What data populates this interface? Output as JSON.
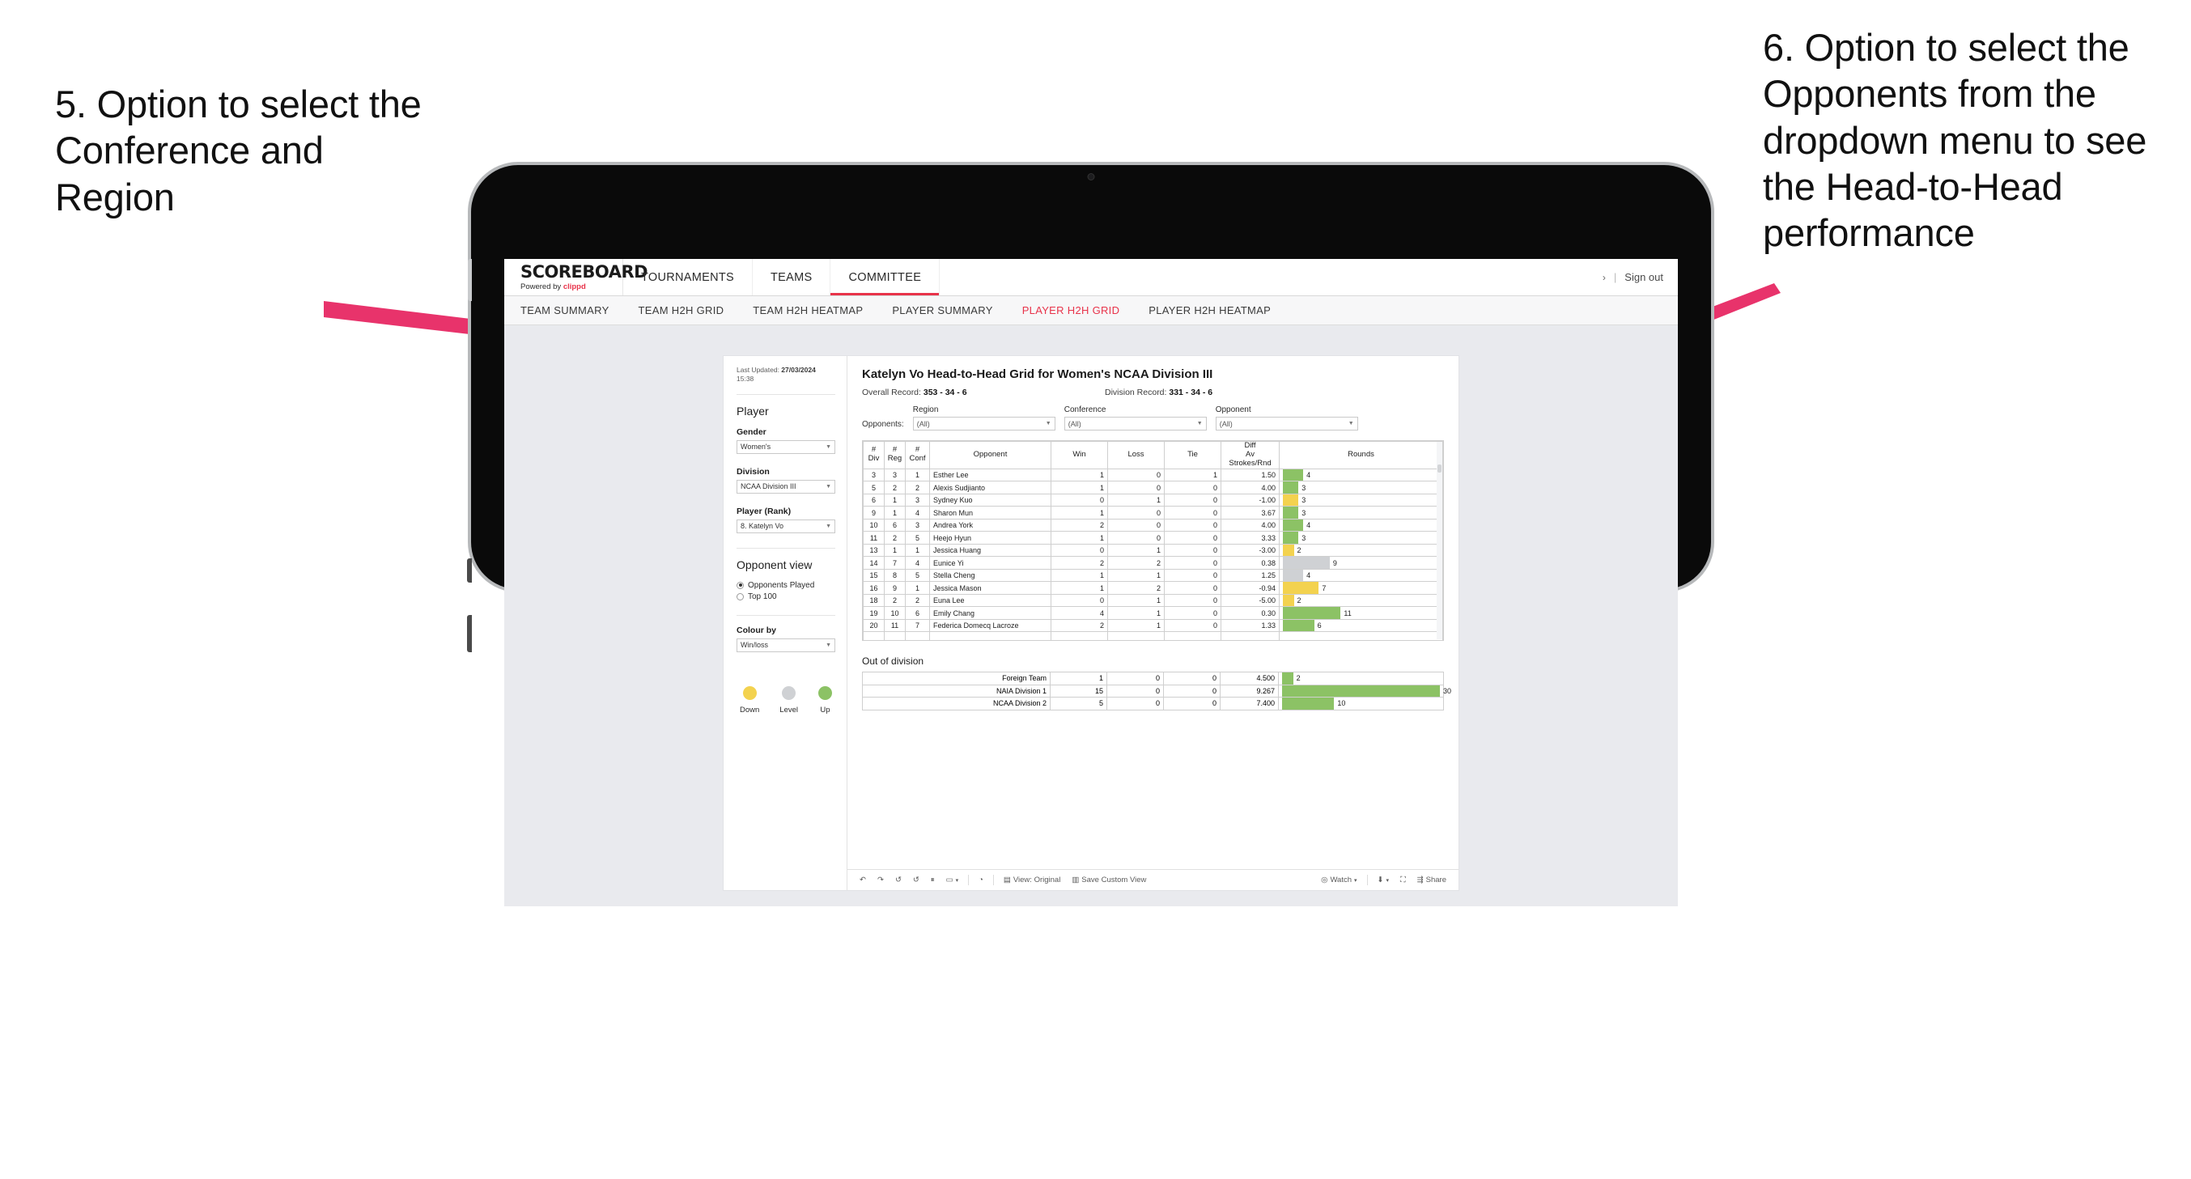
{
  "annotations": {
    "left": "5. Option to select the Conference and Region",
    "right": "6. Option to select the Opponents from the dropdown menu to see the Head-to-Head performance",
    "arrow_color": "#e8336b"
  },
  "app": {
    "brand": {
      "title": "SCOREBOARD",
      "powered_prefix": "Powered by ",
      "powered_name": "clippd"
    },
    "topnav": [
      {
        "label": "TOURNAMENTS",
        "active": false
      },
      {
        "label": "TEAMS",
        "active": false
      },
      {
        "label": "COMMITTEE",
        "active": true
      }
    ],
    "topbar_right": {
      "chevron": "›",
      "divider": "|",
      "sign_out": "Sign out"
    },
    "subnav": [
      {
        "label": "TEAM SUMMARY",
        "active": false
      },
      {
        "label": "TEAM H2H GRID",
        "active": false
      },
      {
        "label": "TEAM H2H HEATMAP",
        "active": false
      },
      {
        "label": "PLAYER SUMMARY",
        "active": false
      },
      {
        "label": "PLAYER H2H GRID",
        "active": true
      },
      {
        "label": "PLAYER H2H HEATMAP",
        "active": false
      }
    ]
  },
  "sidebar": {
    "last_updated_label": "Last Updated: ",
    "last_updated_value": "27/03/2024",
    "last_updated_time": "15:38",
    "player_heading": "Player",
    "gender_label": "Gender",
    "gender_value": "Women's",
    "division_label": "Division",
    "division_value": "NCAA Division III",
    "player_rank_label": "Player (Rank)",
    "player_rank_value": "8. Katelyn Vo",
    "opponent_view_heading": "Opponent view",
    "opponent_view_options": [
      {
        "label": "Opponents Played",
        "selected": true
      },
      {
        "label": "Top 100",
        "selected": false
      }
    ],
    "colour_by_label": "Colour by",
    "colour_by_value": "Win/loss",
    "legend": [
      {
        "label": "Down",
        "color": "#f3d24f"
      },
      {
        "label": "Level",
        "color": "#cfd1d4"
      },
      {
        "label": "Up",
        "color": "#8cc265"
      }
    ]
  },
  "main": {
    "title": "Katelyn Vo Head-to-Head Grid for Women's NCAA Division III",
    "overall_record_label": "Overall Record: ",
    "overall_record_value": "353 - 34 - 6",
    "division_record_label": "Division Record: ",
    "division_record_value": "331 - 34 - 6",
    "opponents_label": "Opponents:",
    "filters": [
      {
        "label": "Region",
        "value": "(All)"
      },
      {
        "label": "Conference",
        "value": "(All)"
      },
      {
        "label": "Opponent",
        "value": "(All)"
      }
    ],
    "out_of_division_title": "Out of division"
  },
  "chart_data": {
    "type": "table",
    "title": "Katelyn Vo Head-to-Head Grid for Women's NCAA Division III",
    "columns": [
      "# Div",
      "# Reg",
      "# Conf",
      "Opponent",
      "Win",
      "Loss",
      "Tie",
      "Diff Av Strokes/Rnd",
      "Rounds"
    ],
    "rounds_max": 30,
    "rows": [
      {
        "div": "3",
        "reg": "3",
        "conf": "1",
        "opponent": "Esther Lee",
        "win": "1",
        "loss": "0",
        "tie": "1",
        "diff": "1.50",
        "rounds": 4,
        "color": "up"
      },
      {
        "div": "5",
        "reg": "2",
        "conf": "2",
        "opponent": "Alexis Sudjianto",
        "win": "1",
        "loss": "0",
        "tie": "0",
        "diff": "4.00",
        "rounds": 3,
        "color": "up"
      },
      {
        "div": "6",
        "reg": "1",
        "conf": "3",
        "opponent": "Sydney Kuo",
        "win": "0",
        "loss": "1",
        "tie": "0",
        "diff": "-1.00",
        "rounds": 3,
        "color": "down"
      },
      {
        "div": "9",
        "reg": "1",
        "conf": "4",
        "opponent": "Sharon Mun",
        "win": "1",
        "loss": "0",
        "tie": "0",
        "diff": "3.67",
        "rounds": 3,
        "color": "up"
      },
      {
        "div": "10",
        "reg": "6",
        "conf": "3",
        "opponent": "Andrea York",
        "win": "2",
        "loss": "0",
        "tie": "0",
        "diff": "4.00",
        "rounds": 4,
        "color": "up"
      },
      {
        "div": "11",
        "reg": "2",
        "conf": "5",
        "opponent": "Heejo Hyun",
        "win": "1",
        "loss": "0",
        "tie": "0",
        "diff": "3.33",
        "rounds": 3,
        "color": "up"
      },
      {
        "div": "13",
        "reg": "1",
        "conf": "1",
        "opponent": "Jessica Huang",
        "win": "0",
        "loss": "1",
        "tie": "0",
        "diff": "-3.00",
        "rounds": 2,
        "color": "down"
      },
      {
        "div": "14",
        "reg": "7",
        "conf": "4",
        "opponent": "Eunice Yi",
        "win": "2",
        "loss": "2",
        "tie": "0",
        "diff": "0.38",
        "rounds": 9,
        "color": "level",
        "diff_color": "up"
      },
      {
        "div": "15",
        "reg": "8",
        "conf": "5",
        "opponent": "Stella Cheng",
        "win": "1",
        "loss": "1",
        "tie": "0",
        "diff": "1.25",
        "rounds": 4,
        "color": "level",
        "diff_color": "up"
      },
      {
        "div": "16",
        "reg": "9",
        "conf": "1",
        "opponent": "Jessica Mason",
        "win": "1",
        "loss": "2",
        "tie": "0",
        "diff": "-0.94",
        "rounds": 7,
        "color": "down"
      },
      {
        "div": "18",
        "reg": "2",
        "conf": "2",
        "opponent": "Euna Lee",
        "win": "0",
        "loss": "1",
        "tie": "0",
        "diff": "-5.00",
        "rounds": 2,
        "color": "down"
      },
      {
        "div": "19",
        "reg": "10",
        "conf": "6",
        "opponent": "Emily Chang",
        "win": "4",
        "loss": "1",
        "tie": "0",
        "diff": "0.30",
        "rounds": 11,
        "color": "up"
      },
      {
        "div": "20",
        "reg": "11",
        "conf": "7",
        "opponent": "Federica Domecq Lacroze",
        "win": "2",
        "loss": "1",
        "tie": "0",
        "diff": "1.33",
        "rounds": 6,
        "color": "up"
      }
    ],
    "out_of_division": {
      "rounds_max": 30,
      "rows": [
        {
          "name": "Foreign Team",
          "win": "1",
          "loss": "0",
          "tie": "0",
          "diff": "4.500",
          "rounds": 2,
          "color": "up"
        },
        {
          "name": "NAIA Division 1",
          "win": "15",
          "loss": "0",
          "tie": "0",
          "diff": "9.267",
          "rounds": 30,
          "color": "up"
        },
        {
          "name": "NCAA Division 2",
          "win": "5",
          "loss": "0",
          "tie": "0",
          "diff": "7.400",
          "rounds": 10,
          "color": "up"
        }
      ]
    }
  },
  "toolbar": {
    "items": [
      {
        "name": "undo-icon",
        "glyph": "↶",
        "label": ""
      },
      {
        "name": "redo-icon",
        "glyph": "↷",
        "label": ""
      },
      {
        "name": "revert-icon",
        "glyph": "↺",
        "label": ""
      },
      {
        "name": "refresh-icon",
        "glyph": "↺",
        "label": ""
      },
      {
        "name": "pause-icon",
        "glyph": "⏸",
        "label": ""
      },
      {
        "name": "loop-icon",
        "glyph": "▭",
        "label": "",
        "caret": true
      },
      {
        "name": "clock-icon",
        "glyph": "◔",
        "label": ""
      },
      {
        "name": "view-original-button",
        "glyph": "▤",
        "label": "View: Original"
      },
      {
        "name": "save-custom-view-button",
        "glyph": "▥",
        "label": "Save Custom View"
      },
      {
        "name": "watch-button",
        "glyph": "◎",
        "label": "Watch",
        "caret": true
      },
      {
        "name": "download-button",
        "glyph": "⬇",
        "label": "",
        "caret": true
      },
      {
        "name": "fullscreen-button",
        "glyph": "⛶",
        "label": ""
      },
      {
        "name": "share-button",
        "glyph": "⇶",
        "label": "Share"
      }
    ]
  }
}
